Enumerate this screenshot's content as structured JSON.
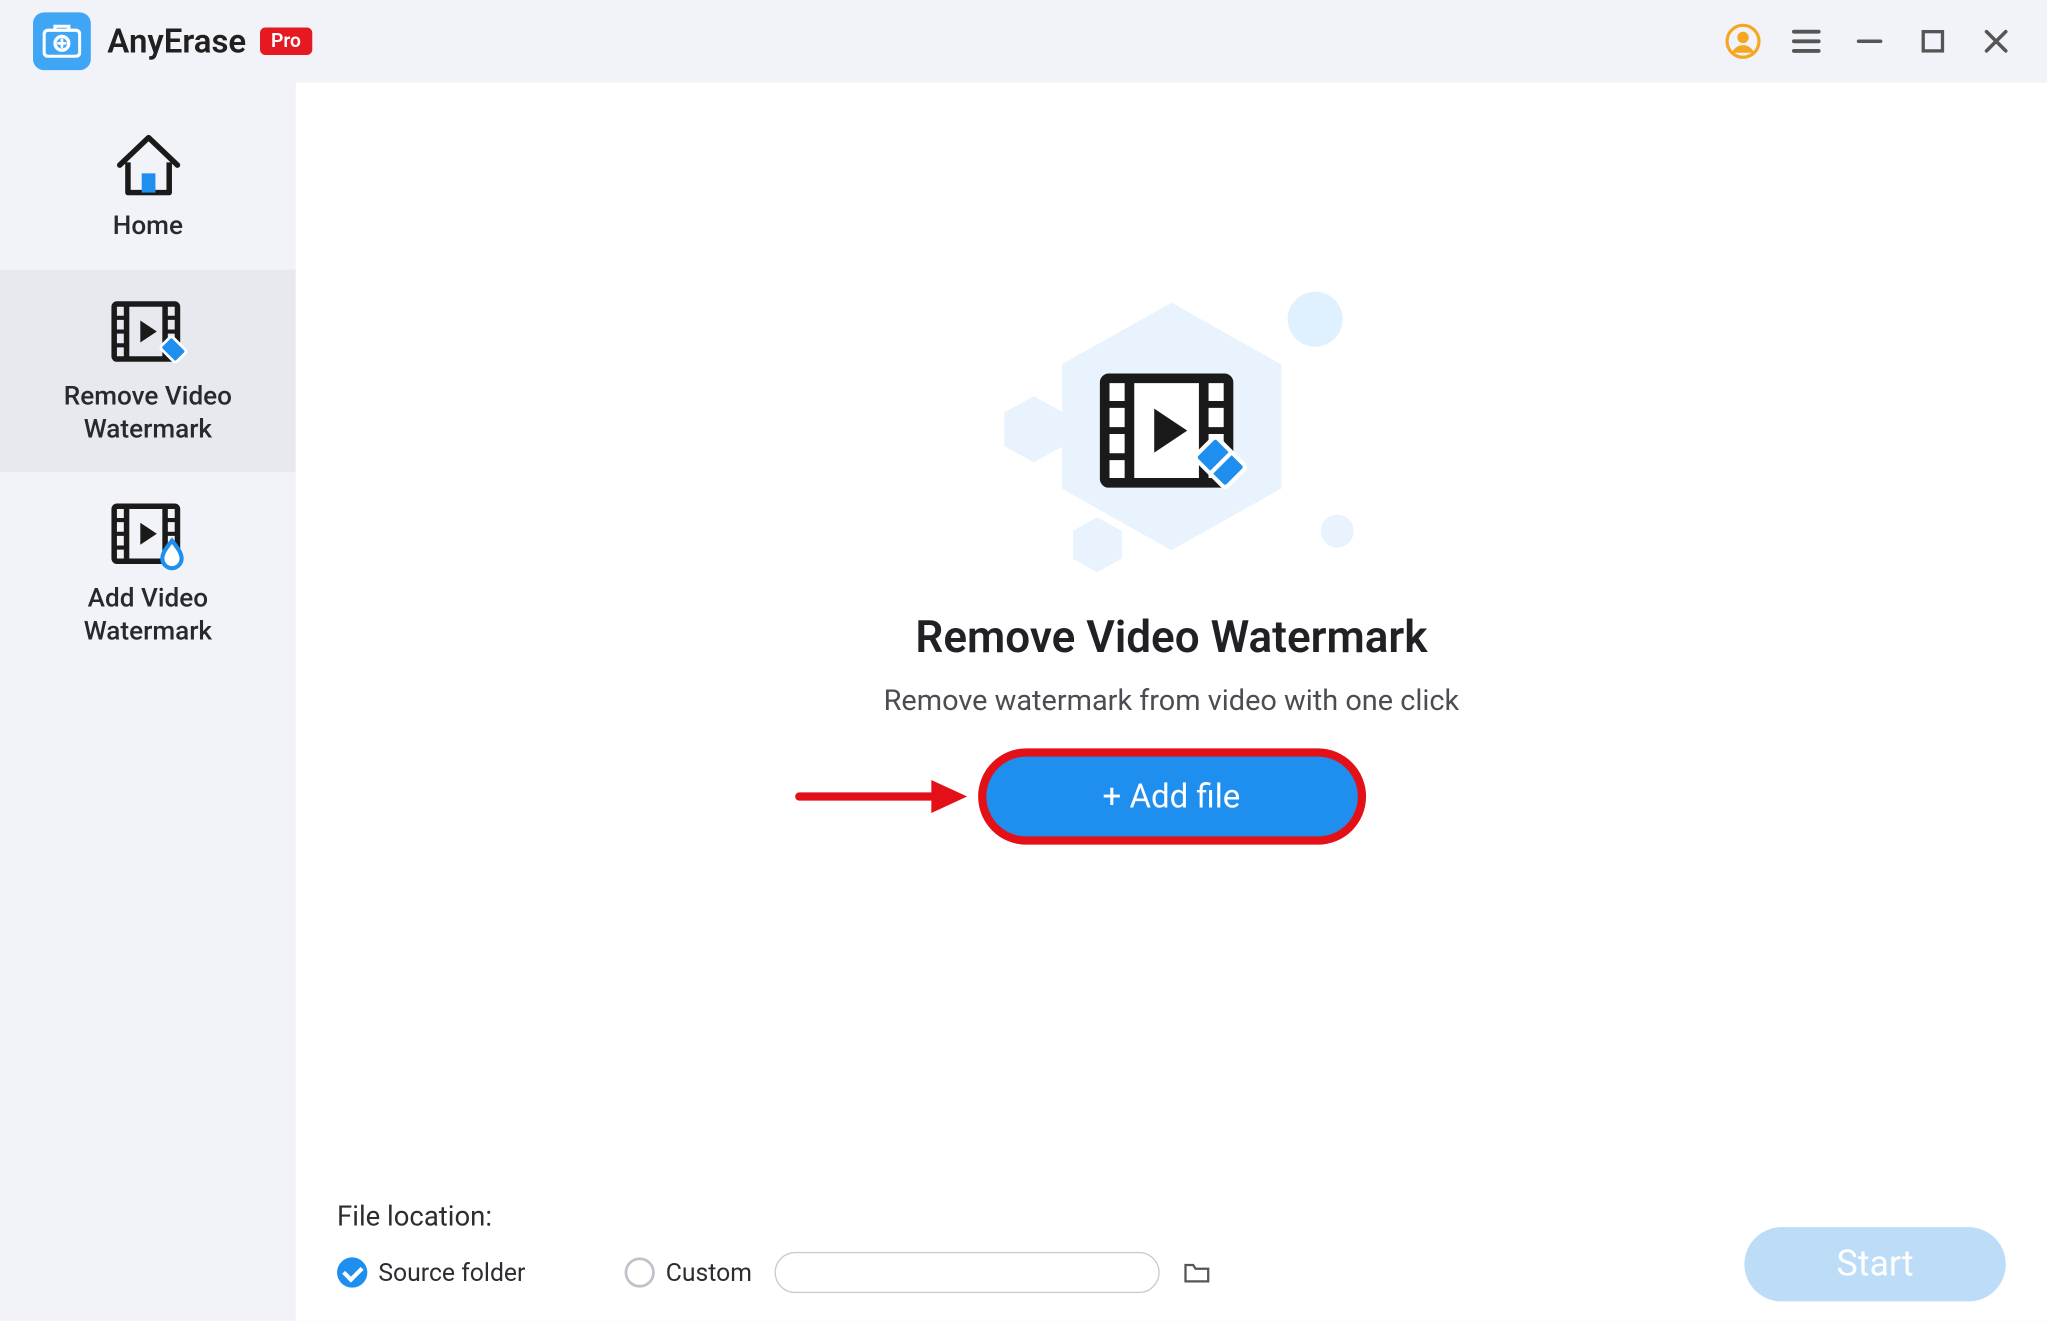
{
  "app": {
    "title": "AnyErase",
    "badge": "Pro"
  },
  "sidebar": {
    "items": [
      {
        "label": "Home"
      },
      {
        "label": "Remove Video\nWatermark"
      },
      {
        "label": "Add Video\nWatermark"
      }
    ]
  },
  "main": {
    "title": "Remove Video Watermark",
    "subtitle": "Remove watermark from video with one click",
    "add_button": "+ Add file"
  },
  "footer": {
    "location_label": "File location:",
    "option_source": "Source folder",
    "option_custom": "Custom",
    "start": "Start"
  },
  "colors": {
    "accent": "#1f8fef",
    "highlight": "#e31117",
    "user": "#f5a623"
  }
}
